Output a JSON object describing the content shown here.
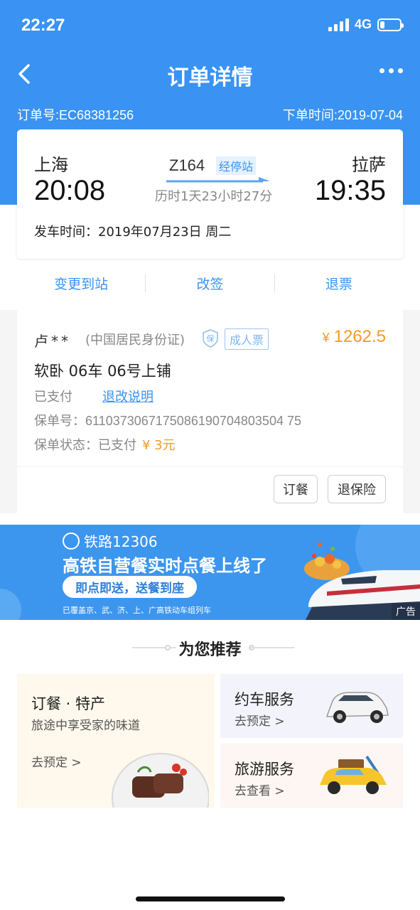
{
  "status": {
    "time": "22:27",
    "network": "4G"
  },
  "nav": {
    "title": "订单详情"
  },
  "order": {
    "number_label": "订单号:EC68381256",
    "time_label": "下单时间:2019-07-04"
  },
  "trip": {
    "from_station": "上海",
    "from_time": "20:08",
    "to_station": "拉萨",
    "to_time": "19:35",
    "train_no": "Z164",
    "stops_label": "经停站",
    "duration": "历时1天23小时27分",
    "depart_label": "发车时间：",
    "depart_date": "2019年07月23日 周二"
  },
  "actions": [
    "变更到站",
    "改签",
    "退票"
  ],
  "passenger": {
    "name": "卢**",
    "id_type": "(中国居民身份证)",
    "insurance_icon_label": "保",
    "ticket_type": "成人票",
    "currency": "¥",
    "price": "1262.5",
    "seat": "软卧 06车 06号上铺",
    "paid": "已支付",
    "rules_link": "退改说明",
    "policy_no": "保单号：6110373067175086190704803504 75",
    "insurance_status_label": "保单状态：已支付",
    "insurance_amount": "¥ 3元",
    "meal_button": "订餐",
    "refund_insurance_button": "退保险"
  },
  "banner": {
    "logo_text": "铁路12306",
    "title": "高铁自营餐实时点餐上线了",
    "pill": "即点即送，送餐到座",
    "footnote": "已覆盖京、武、济、上、广高铁动车组列车",
    "ad_label": "广告"
  },
  "recommend": {
    "title": "为您推荐",
    "food": {
      "title": "订餐 · 特产",
      "subtitle": "旅途中享受家的味道",
      "link": "去预定 >"
    },
    "car": {
      "title": "约车服务",
      "link": "去预定 >"
    },
    "tour": {
      "title": "旅游服务",
      "link": "去查看 >"
    }
  },
  "colors": {
    "brand_blue": "#3a93f3",
    "price_orange": "#f39c1f"
  }
}
